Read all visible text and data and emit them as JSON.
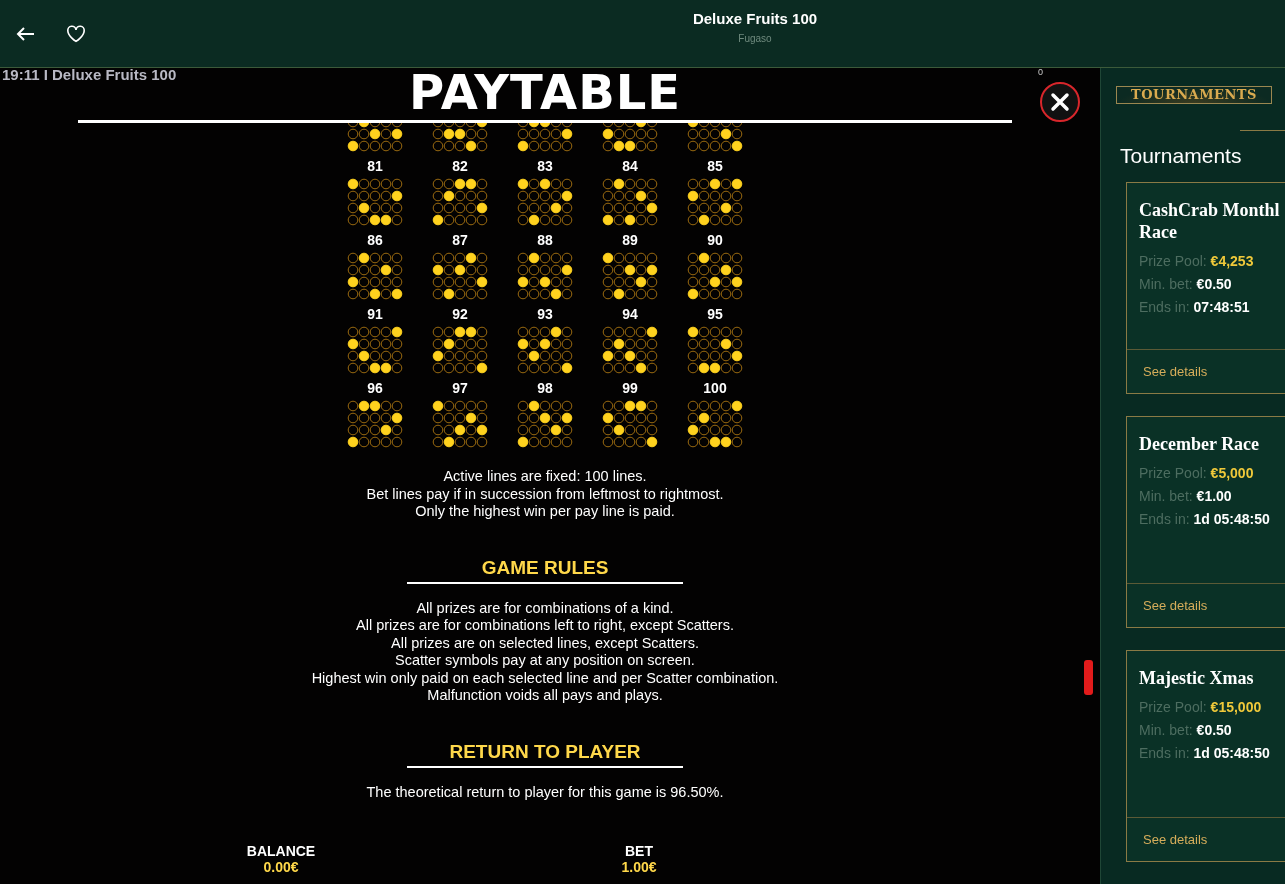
{
  "header": {
    "title": "Deluxe Fruits 100",
    "provider": "Fugaso"
  },
  "game": {
    "clock_title": "19:11 I Deluxe Fruits 100",
    "counter": "0",
    "paytable_title": "PAYTABLE",
    "lines": [
      {
        "rows": [
          [
            false,
            true,
            false,
            false,
            false
          ],
          [
            false,
            false,
            true,
            false,
            true
          ],
          [
            true,
            false,
            false,
            false,
            false
          ]
        ]
      },
      {
        "rows": [
          [
            false,
            false,
            false,
            false,
            true
          ],
          [
            false,
            true,
            true,
            false,
            false
          ],
          [
            false,
            false,
            false,
            true,
            false
          ]
        ]
      },
      {
        "rows": [
          [
            false,
            true,
            true,
            false,
            false
          ],
          [
            false,
            false,
            false,
            false,
            true
          ],
          [
            true,
            false,
            false,
            false,
            false
          ]
        ]
      },
      {
        "rows": [
          [
            false,
            false,
            false,
            true,
            false
          ],
          [
            true,
            false,
            false,
            false,
            false
          ],
          [
            false,
            true,
            true,
            false,
            false
          ]
        ]
      },
      {
        "rows": [
          [
            true,
            false,
            false,
            false,
            false
          ],
          [
            false,
            false,
            false,
            true,
            false
          ],
          [
            false,
            false,
            false,
            false,
            true
          ]
        ]
      },
      {
        "number": "81",
        "rows": [
          [
            true,
            false,
            false,
            false,
            false
          ],
          [
            false,
            false,
            false,
            false,
            true
          ],
          [
            false,
            true,
            false,
            false,
            false
          ],
          [
            false,
            false,
            true,
            true,
            false
          ]
        ]
      },
      {
        "number": "82",
        "rows": [
          [
            false,
            false,
            true,
            true,
            false
          ],
          [
            false,
            true,
            false,
            false,
            false
          ],
          [
            false,
            false,
            false,
            false,
            true
          ],
          [
            true,
            false,
            false,
            false,
            false
          ]
        ]
      },
      {
        "number": "83",
        "rows": [
          [
            true,
            false,
            true,
            false,
            false
          ],
          [
            false,
            false,
            false,
            false,
            true
          ],
          [
            false,
            false,
            false,
            true,
            false
          ],
          [
            false,
            true,
            false,
            false,
            false
          ]
        ]
      },
      {
        "number": "84",
        "rows": [
          [
            false,
            true,
            false,
            false,
            false
          ],
          [
            false,
            false,
            false,
            true,
            false
          ],
          [
            false,
            false,
            false,
            false,
            true
          ],
          [
            true,
            false,
            true,
            false,
            false
          ]
        ]
      },
      {
        "number": "85",
        "rows": [
          [
            false,
            false,
            true,
            false,
            true
          ],
          [
            true,
            false,
            false,
            false,
            false
          ],
          [
            false,
            false,
            false,
            true,
            false
          ],
          [
            false,
            true,
            false,
            false,
            false
          ]
        ]
      },
      {
        "number": "86",
        "rows": [
          [
            false,
            true,
            false,
            false,
            false
          ],
          [
            false,
            false,
            false,
            true,
            false
          ],
          [
            true,
            false,
            false,
            false,
            false
          ],
          [
            false,
            false,
            true,
            false,
            true
          ]
        ]
      },
      {
        "number": "87",
        "rows": [
          [
            false,
            false,
            false,
            true,
            false
          ],
          [
            true,
            false,
            true,
            false,
            false
          ],
          [
            false,
            false,
            false,
            false,
            true
          ],
          [
            false,
            true,
            false,
            false,
            false
          ]
        ]
      },
      {
        "number": "88",
        "rows": [
          [
            false,
            true,
            false,
            false,
            false
          ],
          [
            false,
            false,
            false,
            false,
            true
          ],
          [
            true,
            false,
            true,
            false,
            false
          ],
          [
            false,
            false,
            false,
            true,
            false
          ]
        ]
      },
      {
        "number": "89",
        "rows": [
          [
            true,
            false,
            false,
            false,
            false
          ],
          [
            false,
            false,
            true,
            false,
            true
          ],
          [
            false,
            false,
            false,
            true,
            false
          ],
          [
            false,
            true,
            false,
            false,
            false
          ]
        ]
      },
      {
        "number": "90",
        "rows": [
          [
            false,
            true,
            false,
            false,
            false
          ],
          [
            false,
            false,
            false,
            true,
            false
          ],
          [
            false,
            false,
            true,
            false,
            true
          ],
          [
            true,
            false,
            false,
            false,
            false
          ]
        ]
      },
      {
        "number": "91",
        "rows": [
          [
            false,
            false,
            false,
            false,
            true
          ],
          [
            true,
            false,
            false,
            false,
            false
          ],
          [
            false,
            true,
            false,
            false,
            false
          ],
          [
            false,
            false,
            true,
            true,
            false
          ]
        ]
      },
      {
        "number": "92",
        "rows": [
          [
            false,
            false,
            true,
            true,
            false
          ],
          [
            false,
            true,
            false,
            false,
            false
          ],
          [
            true,
            false,
            false,
            false,
            false
          ],
          [
            false,
            false,
            false,
            false,
            true
          ]
        ]
      },
      {
        "number": "93",
        "rows": [
          [
            false,
            false,
            false,
            true,
            false
          ],
          [
            true,
            false,
            true,
            false,
            false
          ],
          [
            false,
            true,
            false,
            false,
            false
          ],
          [
            false,
            false,
            false,
            false,
            true
          ]
        ]
      },
      {
        "number": "94",
        "rows": [
          [
            false,
            false,
            false,
            false,
            true
          ],
          [
            false,
            true,
            false,
            false,
            false
          ],
          [
            true,
            false,
            true,
            false,
            false
          ],
          [
            false,
            false,
            false,
            true,
            false
          ]
        ]
      },
      {
        "number": "95",
        "rows": [
          [
            true,
            false,
            false,
            false,
            false
          ],
          [
            false,
            false,
            false,
            true,
            false
          ],
          [
            false,
            false,
            false,
            false,
            true
          ],
          [
            false,
            true,
            true,
            false,
            false
          ]
        ]
      },
      {
        "number": "96",
        "rows": [
          [
            false,
            true,
            true,
            false,
            false
          ],
          [
            false,
            false,
            false,
            false,
            true
          ],
          [
            false,
            false,
            false,
            true,
            false
          ],
          [
            true,
            false,
            false,
            false,
            false
          ]
        ]
      },
      {
        "number": "97",
        "rows": [
          [
            true,
            false,
            false,
            false,
            false
          ],
          [
            false,
            false,
            false,
            true,
            false
          ],
          [
            false,
            false,
            true,
            false,
            true
          ],
          [
            false,
            true,
            false,
            false,
            false
          ]
        ]
      },
      {
        "number": "98",
        "rows": [
          [
            false,
            true,
            false,
            false,
            false
          ],
          [
            false,
            false,
            true,
            false,
            true
          ],
          [
            false,
            false,
            false,
            true,
            false
          ],
          [
            true,
            false,
            false,
            false,
            false
          ]
        ]
      },
      {
        "number": "99",
        "rows": [
          [
            false,
            false,
            true,
            true,
            false
          ],
          [
            true,
            false,
            false,
            false,
            false
          ],
          [
            false,
            true,
            false,
            false,
            false
          ],
          [
            false,
            false,
            false,
            false,
            true
          ]
        ]
      },
      {
        "number": "100",
        "rows": [
          [
            false,
            false,
            false,
            false,
            true
          ],
          [
            false,
            true,
            false,
            false,
            false
          ],
          [
            true,
            false,
            false,
            false,
            false
          ],
          [
            false,
            false,
            true,
            true,
            false
          ]
        ]
      }
    ],
    "line_notes": [
      "Active lines are fixed: 100 lines.",
      "Bet lines pay if in succession from leftmost to rightmost.",
      "Only the highest win per pay line is paid."
    ],
    "sections": [
      {
        "heading": "GAME RULES",
        "paragraphs": [
          "All prizes are for combinations of a kind.",
          "All prizes are for combinations left to right, except Scatters.",
          "All prizes are on selected lines, except Scatters.",
          "Scatter symbols pay at any position on screen.",
          "Highest win only paid on each selected line and per Scatter combination.",
          "Malfunction voids all pays and plays."
        ]
      },
      {
        "heading": "RETURN TO PLAYER",
        "paragraphs": [
          "The theoretical return to player for this game is 96.50%."
        ]
      }
    ],
    "footer": [
      {
        "label": "BALANCE",
        "value": "0.00€"
      },
      {
        "label": "BET",
        "value": "1.00€"
      }
    ]
  },
  "sidebar": {
    "tab": "TOURNAMENTS",
    "heading": "Tournaments",
    "tournaments": [
      {
        "name": "CashCrab Monthl Race",
        "prize_label": "Prize Pool:",
        "prize": "€4,253",
        "bet_label": "Min. bet:",
        "bet": "€0.50",
        "ends_label": "Ends in:",
        "ends": "07:48:51",
        "link": "See details"
      },
      {
        "name": "December Race",
        "prize_label": "Prize Pool:",
        "prize": "€5,000",
        "bet_label": "Min. bet:",
        "bet": "€1.00",
        "ends_label": "Ends in:",
        "ends": "1d 05:48:50",
        "link": "See details"
      },
      {
        "name": "Majestic Xmas",
        "prize_label": "Prize Pool:",
        "prize": "€15,000",
        "bet_label": "Min. bet:",
        "bet": "€0.50",
        "ends_label": "Ends in:",
        "ends": "1d 05:48:50",
        "link": "See details"
      }
    ]
  }
}
